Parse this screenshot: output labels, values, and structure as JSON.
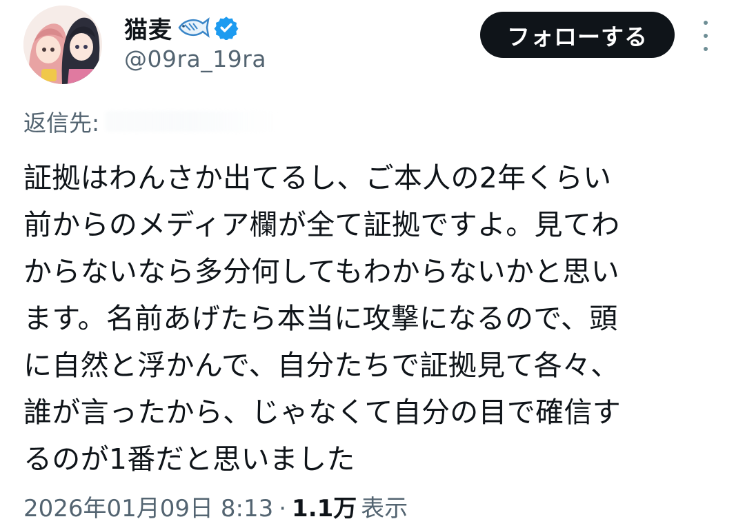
{
  "author": {
    "display_name": "猫麦",
    "handle": "@09ra_19ra"
  },
  "follow_button_label": "フォローする",
  "reply": {
    "label": "返信先:"
  },
  "tweet": {
    "text": "証拠はわんさか出てるし、ご本人の2年くらい\n前からのメディア欄が全て証拠ですよ。見てわ\nからないなら多分何してもわからないかと思い\nます。名前あげたら本当に攻撃になるので、頭\nに自然と浮かんで、自分たちで証拠見て各々、\n誰が言ったから、じゃなくて自分の目で確信す\nるのが1番だと思いました"
  },
  "meta": {
    "datetime": "2026年01月09日 8:13",
    "separator": "·",
    "views_count": "1.1万",
    "views_label": "表示"
  },
  "colors": {
    "primary_text": "#0f1419",
    "secondary_text": "#536471",
    "verified_badge": "#1d9bf0",
    "follow_button_bg": "#0f1419"
  },
  "icons": [
    "avatar-image",
    "fish-emoji-icon",
    "verified-badge-icon",
    "more-vertical-icon"
  ]
}
